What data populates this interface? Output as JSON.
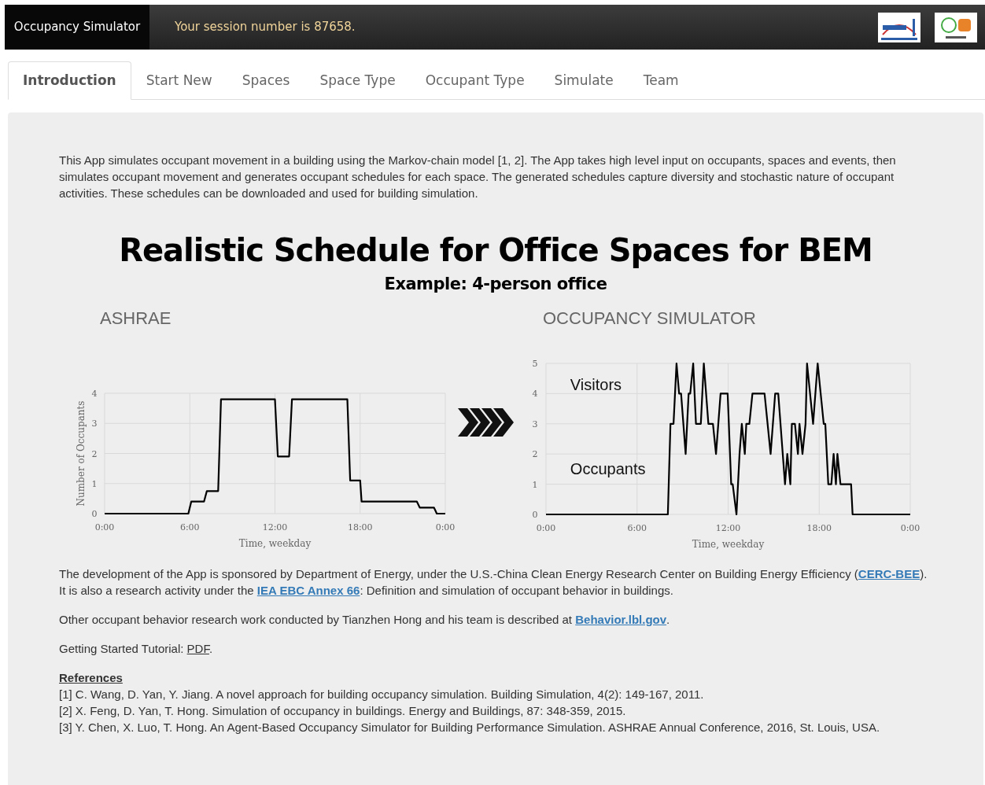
{
  "navbar": {
    "brand": "Occupancy Simulator",
    "session_text": "Your session number is 87658."
  },
  "tabs": [
    {
      "label": "Introduction",
      "selected": true
    },
    {
      "label": "Start New",
      "selected": false
    },
    {
      "label": "Spaces",
      "selected": false
    },
    {
      "label": "Space Type",
      "selected": false
    },
    {
      "label": "Occupant Type",
      "selected": false
    },
    {
      "label": "Simulate",
      "selected": false
    },
    {
      "label": "Team",
      "selected": false
    }
  ],
  "intro": "This App simulates occupant movement in a building using the Markov-chain model [1, 2]. The App takes high level input on occupants, spaces and events, then simulates occupant movement and generates occupant schedules for each space. The generated schedules capture diversity and stochastic nature of occupant activities. These schedules can be downloaded and used for building simulation.",
  "figure": {
    "title": "Realistic Schedule for Office Spaces for BEM",
    "subtitle": "Example: 4-person office",
    "charts": [
      {
        "heading": "ASHRAE",
        "chart_data": {
          "type": "line",
          "grid": true,
          "xlabel": "Time, weekday",
          "ylabel": "Number of Occupants",
          "x": [
            0,
            5.9,
            6.1,
            7,
            7.2,
            8,
            8.2,
            12,
            12.2,
            13,
            13.2,
            17.1,
            17.3,
            18,
            18.1,
            22,
            22.2,
            23.2,
            23.4,
            24
          ],
          "series": [
            {
              "color": "#000000",
              "values": [
                0,
                0,
                0.4,
                0.4,
                0.75,
                0.75,
                3.8,
                3.8,
                1.9,
                1.9,
                3.8,
                3.8,
                1.1,
                1.1,
                0.4,
                0.4,
                0.2,
                0.2,
                0,
                0
              ]
            }
          ],
          "xlim": [
            0,
            24
          ],
          "ylim": [
            0,
            4
          ],
          "xticks": [
            {
              "value": 0,
              "label": "0:00"
            },
            {
              "value": 6,
              "label": "6:00"
            },
            {
              "value": 12,
              "label": "12:00"
            },
            {
              "value": 18,
              "label": "18:00"
            },
            {
              "value": 24,
              "label": "0:00"
            }
          ],
          "yticks": [
            0,
            1,
            2,
            3,
            4
          ]
        }
      },
      {
        "heading": "OCCUPANCY SIMULATOR",
        "chart_data": {
          "type": "line",
          "grid": true,
          "xlabel": "Time, weekday",
          "x": [
            0,
            8.03,
            8.2,
            8.4,
            8.6,
            8.77,
            8.9,
            9.2,
            9.4,
            9.5,
            9.7,
            9.88,
            10.2,
            10.4,
            10.7,
            11,
            11.2,
            11.5,
            11.97,
            12.2,
            12.3,
            12.55,
            12.75,
            12.9,
            13.1,
            13.2,
            13.4,
            13.6,
            14.4,
            14.8,
            15.1,
            15.3,
            15.75,
            15.9,
            16.1,
            16.2,
            16.4,
            16.6,
            16.7,
            16.9,
            17.1,
            17.2,
            17.6,
            17.9,
            18.3,
            18.4,
            18.6,
            18.8,
            18.95,
            19.1,
            19.2,
            19.4,
            20.1,
            20.2,
            24
          ],
          "series": [
            {
              "color": "#000000",
              "values": [
                0,
                0,
                3,
                3,
                5,
                4,
                4,
                2,
                4,
                4,
                5,
                3,
                3,
                5,
                3,
                3,
                2,
                4,
                4,
                1,
                1,
                0,
                2,
                3,
                2,
                3,
                3,
                4,
                4,
                2,
                4,
                4,
                1,
                2,
                1,
                3,
                3,
                2,
                3,
                2,
                3,
                5,
                3,
                5,
                3,
                3,
                1,
                1,
                2,
                1,
                2,
                1,
                1,
                0,
                0
              ]
            }
          ],
          "xlim": [
            0,
            24
          ],
          "ylim": [
            0,
            5
          ],
          "xticks": [
            {
              "value": 0,
              "label": "0:00"
            },
            {
              "value": 6,
              "label": "6:00"
            },
            {
              "value": 12,
              "label": "12:00"
            },
            {
              "value": 18,
              "label": "18:00"
            },
            {
              "value": 24,
              "label": "0:00"
            }
          ],
          "yticks": [
            0,
            1,
            2,
            3,
            4,
            5
          ],
          "annotations": [
            "Visitors",
            "Occupants"
          ]
        }
      }
    ]
  },
  "paragraphs": [
    [
      {
        "kind": "text",
        "text": "The development of the App is sponsored by Department of Energy, under the U.S.-China Clean Energy Research Center on Building Energy Efficiency ("
      },
      {
        "kind": "link",
        "text": "CERC-BEE"
      },
      {
        "kind": "text",
        "text": "). It is also a research activity under the "
      },
      {
        "kind": "link",
        "text": "IEA EBC Annex 66"
      },
      {
        "kind": "text",
        "text": ": Definition and simulation of occupant behavior in buildings."
      }
    ],
    [
      {
        "kind": "text",
        "text": "Other occupant behavior research work conducted by Tianzhen Hong and his team is described at "
      },
      {
        "kind": "link",
        "text": "Behavior.lbl.gov"
      },
      {
        "kind": "text",
        "text": "."
      }
    ],
    [
      {
        "kind": "text",
        "text": "Getting Started Tutorial: "
      },
      {
        "kind": "plainlink",
        "text": "PDF"
      },
      {
        "kind": "text",
        "text": "."
      }
    ]
  ],
  "references": {
    "heading": "References",
    "items": [
      "[1] C. Wang, D. Yan, Y. Jiang. A novel approach for building occupancy simulation. Building Simulation, 4(2): 149-167, 2011.",
      "[2] X. Feng, D. Yan, T. Hong. Simulation of occupancy in buildings. Energy and Buildings, 87: 348-359, 2015.",
      "[3] Y. Chen, X. Luo, T. Hong. An Agent-Based Occupancy Simulator for Building Performance Simulation. ASHRAE Annual Conference, 2016, St. Louis, USA."
    ]
  }
}
